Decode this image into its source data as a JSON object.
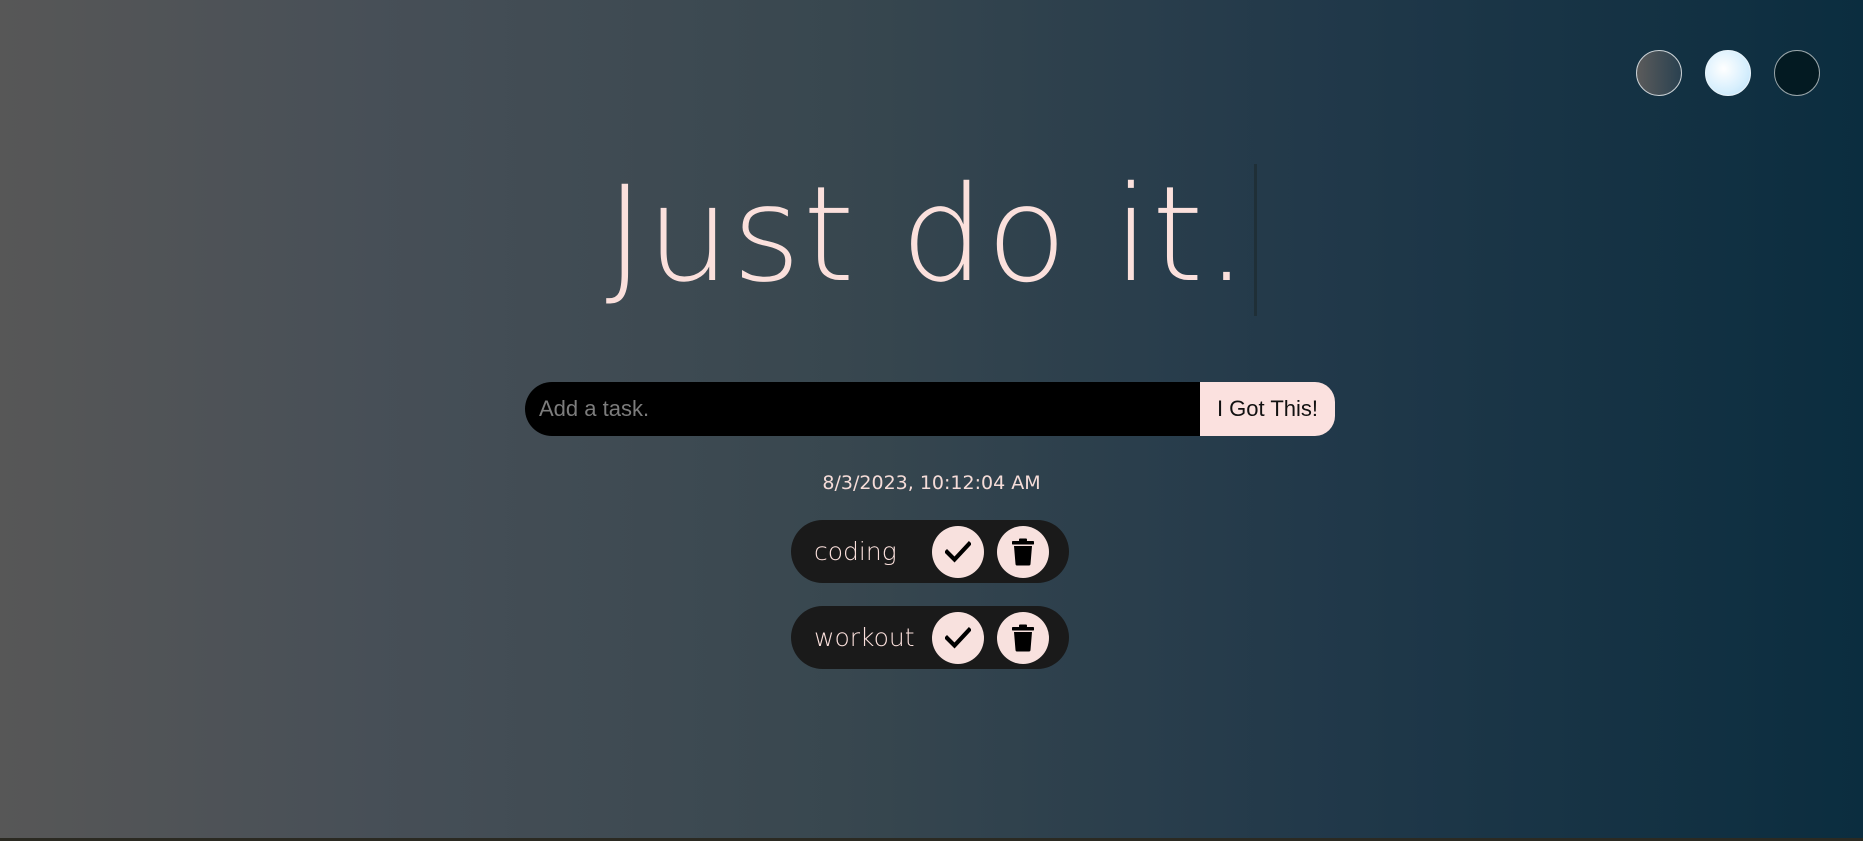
{
  "theme_switcher": {
    "options": [
      {
        "name": "standard-theme",
        "color": "#575757"
      },
      {
        "name": "light-theme",
        "color": "#d7effd"
      },
      {
        "name": "darker-theme",
        "color": "#031a22"
      }
    ]
  },
  "header": {
    "title": "Just do it."
  },
  "task_form": {
    "input_placeholder": "Add a task.",
    "input_value": "",
    "submit_label": "I Got This!"
  },
  "datetime": "8/3/2023, 10:12:04 AM",
  "tasks": [
    {
      "label": "coding",
      "complete_icon": "check-icon",
      "delete_icon": "trash-icon"
    },
    {
      "label": "workout",
      "complete_icon": "check-icon",
      "delete_icon": "trash-icon"
    }
  ],
  "colors": {
    "accent": "#fbe0dc",
    "input_bg": "#000000",
    "task_bg": "#1a1a1a"
  }
}
